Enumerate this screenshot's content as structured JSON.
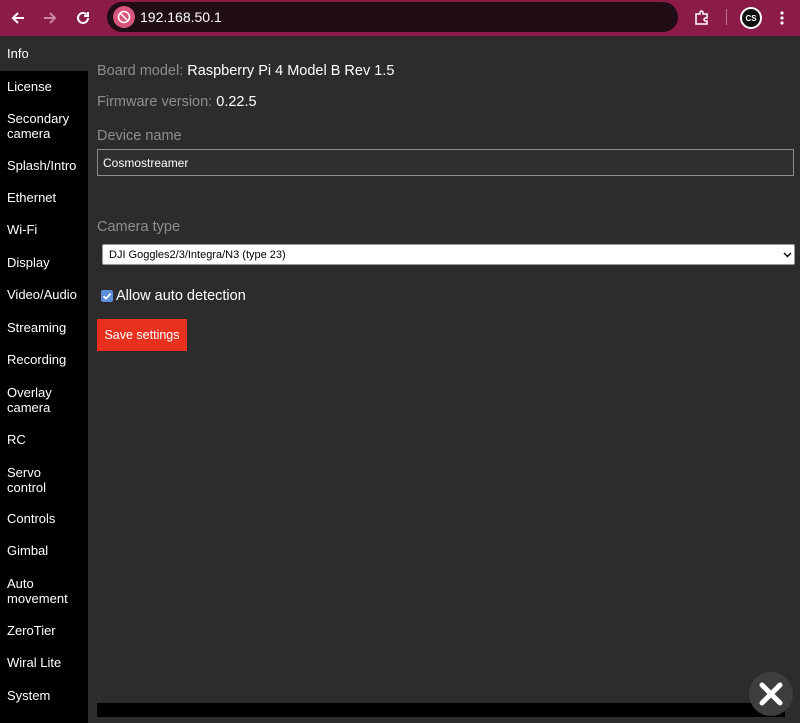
{
  "browser": {
    "url": "192.168.50.1",
    "profile_initials": "CS",
    "icons": [
      "back-arrow-icon",
      "forward-arrow-icon",
      "reload-icon",
      "site-info-icon",
      "extensions-icon",
      "kebab-menu-icon"
    ]
  },
  "sidebar": {
    "items": [
      {
        "label": "Info",
        "active": true
      },
      {
        "label": "License"
      },
      {
        "label": "Secondary camera"
      },
      {
        "label": "Splash/Intro"
      },
      {
        "label": "Ethernet"
      },
      {
        "label": "Wi-Fi"
      },
      {
        "label": "Display"
      },
      {
        "label": "Video/Audio"
      },
      {
        "label": "Streaming"
      },
      {
        "label": "Recording"
      },
      {
        "label": "Overlay camera"
      },
      {
        "label": "RC"
      },
      {
        "label": "Servo control"
      },
      {
        "label": "Controls"
      },
      {
        "label": "Gimbal"
      },
      {
        "label": "Auto movement"
      },
      {
        "label": "ZeroTier"
      },
      {
        "label": "Wiral Lite"
      },
      {
        "label": "System"
      }
    ]
  },
  "main": {
    "board_model_label": "Board model:",
    "board_model_value": "Raspberry Pi 4 Model B Rev 1.5",
    "firmware_label": "Firmware version:",
    "firmware_value": "0.22.5",
    "device_name_label": "Device name",
    "device_name_value": "Cosmostreamer",
    "camera_type_label": "Camera type",
    "camera_type_selected": "DJI Goggles2/3/Integra/N3 (type 23)",
    "auto_detect_label": "Allow auto detection",
    "auto_detect_checked": true,
    "save_label": "Save settings"
  },
  "colors": {
    "toolbar": "#8b1b47",
    "sidebar": "#000000",
    "background": "#2c2c2c",
    "save_button": "#e8301f",
    "checkbox": "#5b8fde"
  }
}
